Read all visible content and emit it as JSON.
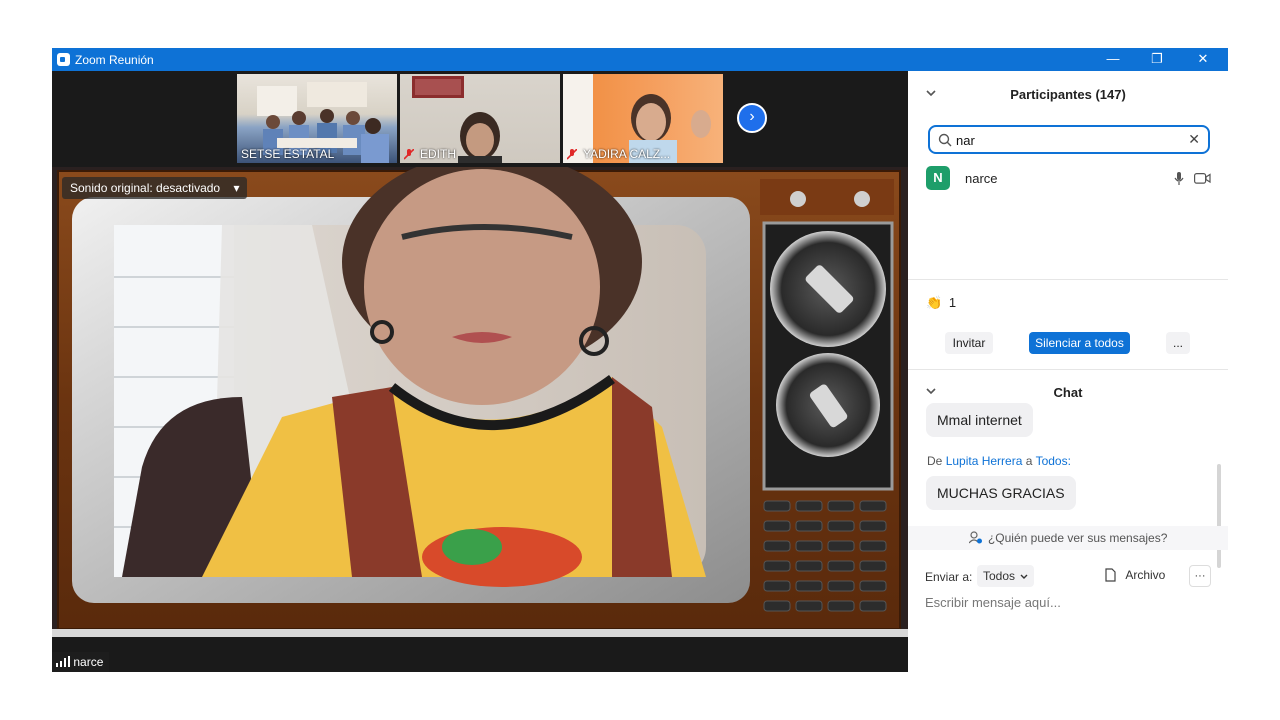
{
  "window": {
    "title": "Zoom Reunión",
    "minimize": "—",
    "restore": "❐",
    "close": "✕"
  },
  "thumbnails": [
    {
      "name": "SETSE ESTATAL",
      "muted": false
    },
    {
      "name": "EDITH",
      "muted": true
    },
    {
      "name": "YADIRA CALZ...",
      "muted": true
    }
  ],
  "next_arrow": "›",
  "audio_pill": {
    "label": "Sonido original: desactivado",
    "caret": "▾"
  },
  "active_speaker": {
    "name": "narce"
  },
  "participants": {
    "header": "Participantes (147)",
    "search_value": "nar",
    "clear": "✕",
    "results": [
      {
        "initial": "N",
        "name": "narce"
      }
    ],
    "reactions": {
      "emoji": "👏",
      "count": "1"
    },
    "buttons": {
      "invite": "Invitar",
      "mute_all": "Silenciar a todos",
      "more": "..."
    }
  },
  "chat": {
    "header": "Chat",
    "messages": [
      {
        "text": "Mmal internet"
      },
      {
        "prefix": "De",
        "sender": "Lupita Herrera",
        "connector": "a",
        "recipient": "Todos:",
        "text": "MUCHAS GRACIAS"
      }
    ],
    "notice": "¿Quién puede ver sus mensajes?",
    "send_to_label": "Enviar a:",
    "send_to_value": "Todos",
    "file_label": "Archivo",
    "more": "···",
    "input_placeholder": "Escribir mensaje aquí..."
  },
  "colors": {
    "accent": "#0e72d6",
    "avatar": "#1e9e6a"
  }
}
